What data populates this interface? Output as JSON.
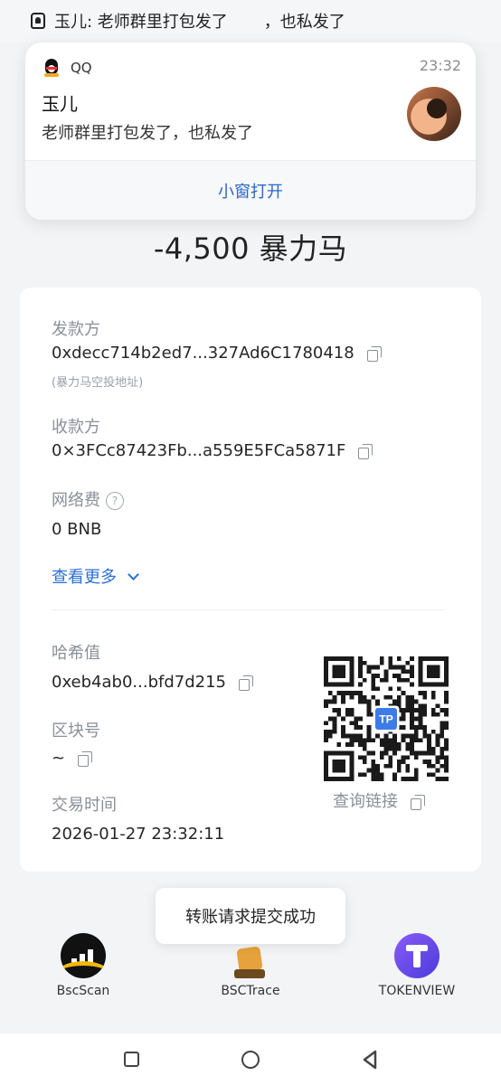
{
  "status_bar": {
    "text_left": "玉儿: 老师群里打包发了",
    "text_right": "，也私发了"
  },
  "notification": {
    "app_name": "QQ",
    "time": "23:32",
    "sender": "玉儿",
    "message": "老师群里打包发了，也私发了",
    "action": "小窗打开"
  },
  "transfer": {
    "amount": "-4,500 暴力马"
  },
  "details": {
    "sender_label": "发款方",
    "sender_address": "0xdecc714b2ed7...327Ad6C1780418",
    "sender_note": "(暴力马空投地址)",
    "receiver_label": "收款方",
    "receiver_address": "0×3FCc87423Fb...a559E5FCa5871F",
    "fee_label": "网络费",
    "fee_value": "0 BNB",
    "more_label": "查看更多",
    "hash_label": "哈希值",
    "hash_value": "0xeb4ab0...bfd7d215",
    "block_label": "区块号",
    "block_value": "~",
    "time_label": "交易时间",
    "time_value": "2026-01-27 23:32:11",
    "qr_link_label": "查询链接",
    "qr_badge": "TP"
  },
  "toast": {
    "text": "转账请求提交成功"
  },
  "explorers": [
    {
      "name": "BscScan",
      "icon": "bscscan-logo-icon"
    },
    {
      "name": "BSCTrace",
      "icon": "bsctrace-logo-icon"
    },
    {
      "name": "TOKENVIEW",
      "icon": "tokenview-logo-icon"
    }
  ],
  "colors": {
    "link_blue": "#2d6fd6",
    "action_blue": "#2b66c4",
    "background": "#f2f4f6",
    "label_gray": "#8a8f99"
  }
}
